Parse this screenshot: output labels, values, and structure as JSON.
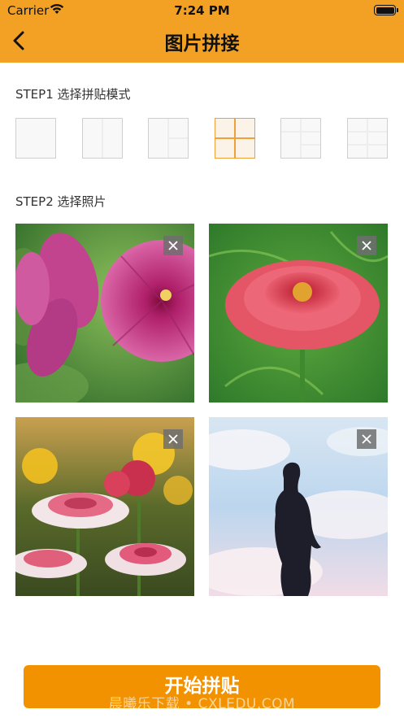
{
  "status_bar": {
    "carrier": "Carrier",
    "time": "7:24 PM"
  },
  "nav": {
    "title": "图片拼接",
    "back_icon": "chevron-left-icon"
  },
  "step1": {
    "label": "STEP1 选择拼贴模式",
    "modes": [
      {
        "name": "single",
        "selected": false
      },
      {
        "name": "two-columns",
        "selected": false
      },
      {
        "name": "left-one-right-two",
        "selected": false
      },
      {
        "name": "grid-2x2",
        "selected": true
      },
      {
        "name": "mixed-five",
        "selected": false
      },
      {
        "name": "grid-3x2",
        "selected": false
      }
    ]
  },
  "step2": {
    "label": "STEP2 选择照片",
    "photos": [
      {
        "subject": "pink-petunia-flowers",
        "delete_icon": "close-icon"
      },
      {
        "subject": "red-zinnia-flower",
        "delete_icon": "close-icon"
      },
      {
        "subject": "pink-white-daisy-flowers",
        "delete_icon": "close-icon"
      },
      {
        "subject": "child-silhouette-sky",
        "delete_icon": "close-icon"
      }
    ]
  },
  "action": {
    "start_label": "开始拼贴"
  },
  "watermark": "晨曦乐下载 • CXLEDU.COM",
  "colors": {
    "accent": "#f2a125",
    "button": "#f39200",
    "selected_mode": "#f0a03a"
  }
}
